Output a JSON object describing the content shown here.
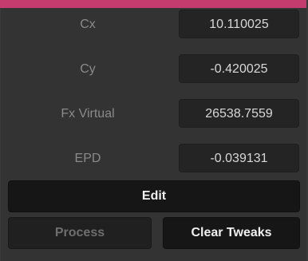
{
  "colors": {
    "accent": "#c43b6d",
    "panel_bg": "#333333",
    "field_bg": "#242424",
    "button_bg": "#161616",
    "label_text": "#8a8a8a",
    "value_text": "#d8d8d8",
    "disabled_text": "#6e6e6e"
  },
  "fields": [
    {
      "label": "Cx",
      "value": "10.110025"
    },
    {
      "label": "Cy",
      "value": "-0.420025"
    },
    {
      "label": "Fx Virtual",
      "value": "26538.7559"
    },
    {
      "label": "EPD",
      "value": "-0.039131"
    }
  ],
  "buttons": {
    "edit": "Edit",
    "process": "Process",
    "clear_tweaks": "Clear Tweaks"
  }
}
